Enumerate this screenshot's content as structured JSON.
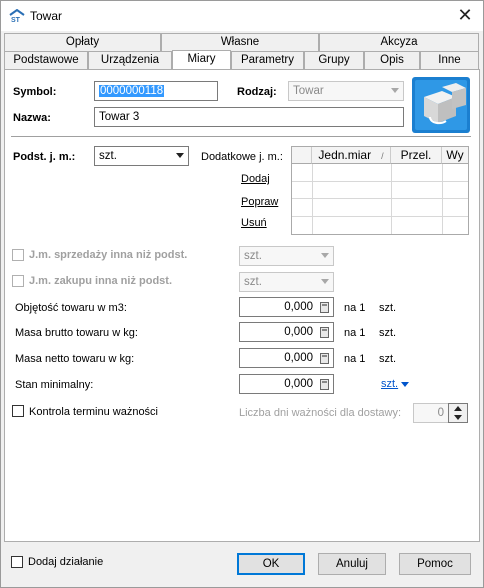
{
  "window": {
    "title": "Towar",
    "icon": "app-logo-icon",
    "close_glyph": "✕"
  },
  "tabs_row1": [
    {
      "label": "Opłaty"
    },
    {
      "label": "Własne"
    },
    {
      "label": "Akcyza"
    }
  ],
  "tabs_row2": [
    {
      "label": "Podstawowe"
    },
    {
      "label": "Urządzenia"
    },
    {
      "label": "Miary",
      "active": true
    },
    {
      "label": "Parametry"
    },
    {
      "label": "Grupy"
    },
    {
      "label": "Opis"
    },
    {
      "label": "Inne"
    }
  ],
  "header": {
    "symbol_label": "Symbol:",
    "symbol_value": "0000000118",
    "rodzaj_label": "Rodzaj:",
    "rodzaj_value": "Towar",
    "nazwa_label": "Nazwa:",
    "nazwa_value": "Towar 3",
    "product_image": "product-boxes-icon"
  },
  "units": {
    "base_label": "Podst. j. m.:",
    "base_value": "szt.",
    "additional_label": "Dodatkowe j. m.:",
    "actions": {
      "add": "Dodaj",
      "edit": "Popraw",
      "delete": "Usuń"
    },
    "grid_columns": [
      "Jedn.miar",
      "Przel.",
      "Wy"
    ],
    "grid_sort_indicator": "/"
  },
  "options": {
    "sale_unit_label": "J.m. sprzedaży inna niż podst.",
    "sale_unit_value": "szt.",
    "purchase_unit_label": "J.m. zakupu inna niż podst.",
    "purchase_unit_value": "szt."
  },
  "measures": {
    "volume_label": "Objętość towaru w m3:",
    "volume_value": "0,000",
    "gross_label": "Masa brutto towaru w kg:",
    "gross_value": "0,000",
    "net_label": "Masa netto towaru w kg:",
    "net_value": "0,000",
    "per_label": "na 1",
    "per_unit": "szt.",
    "min_stock_label": "Stan minimalny:",
    "min_stock_value": "0,000",
    "min_stock_unit": "szt."
  },
  "expiry": {
    "checkbox_label": "Kontrola terminu ważności",
    "days_label": "Liczba dni ważności dla dostawy:",
    "days_value": "0"
  },
  "footer": {
    "add_action_label": "Dodaj działanie",
    "ok": "OK",
    "cancel": "Anuluj",
    "help": "Pomoc"
  }
}
